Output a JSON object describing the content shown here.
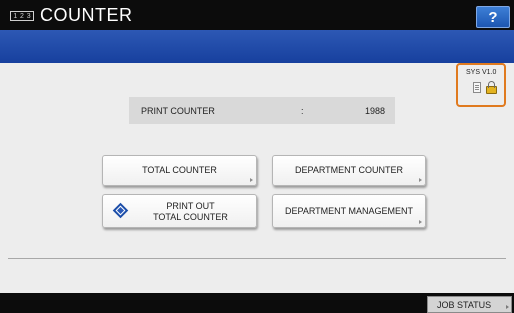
{
  "header": {
    "title": "COUNTER",
    "icon_digits": [
      "1",
      "2",
      "3"
    ],
    "help_label": "?"
  },
  "sys_status": {
    "version": "SYS V1.0",
    "icons": [
      "document-icon",
      "lock-icon"
    ],
    "border_color": "#e07a1f"
  },
  "print_counter": {
    "label": "PRINT COUNTER",
    "separator": ":",
    "value": "1988"
  },
  "buttons": {
    "total_counter": "TOTAL COUNTER",
    "department_counter": "DEPARTMENT COUNTER",
    "print_out_line1": "PRINT OUT",
    "print_out_line2": "TOTAL COUNTER",
    "department_management": "DEPARTMENT MANAGEMENT"
  },
  "footer": {
    "job_status": "JOB STATUS"
  },
  "colors": {
    "titlebar": "#0c0c0c",
    "bluebar": "#1e47a6",
    "help_button": "#2a68c4"
  }
}
